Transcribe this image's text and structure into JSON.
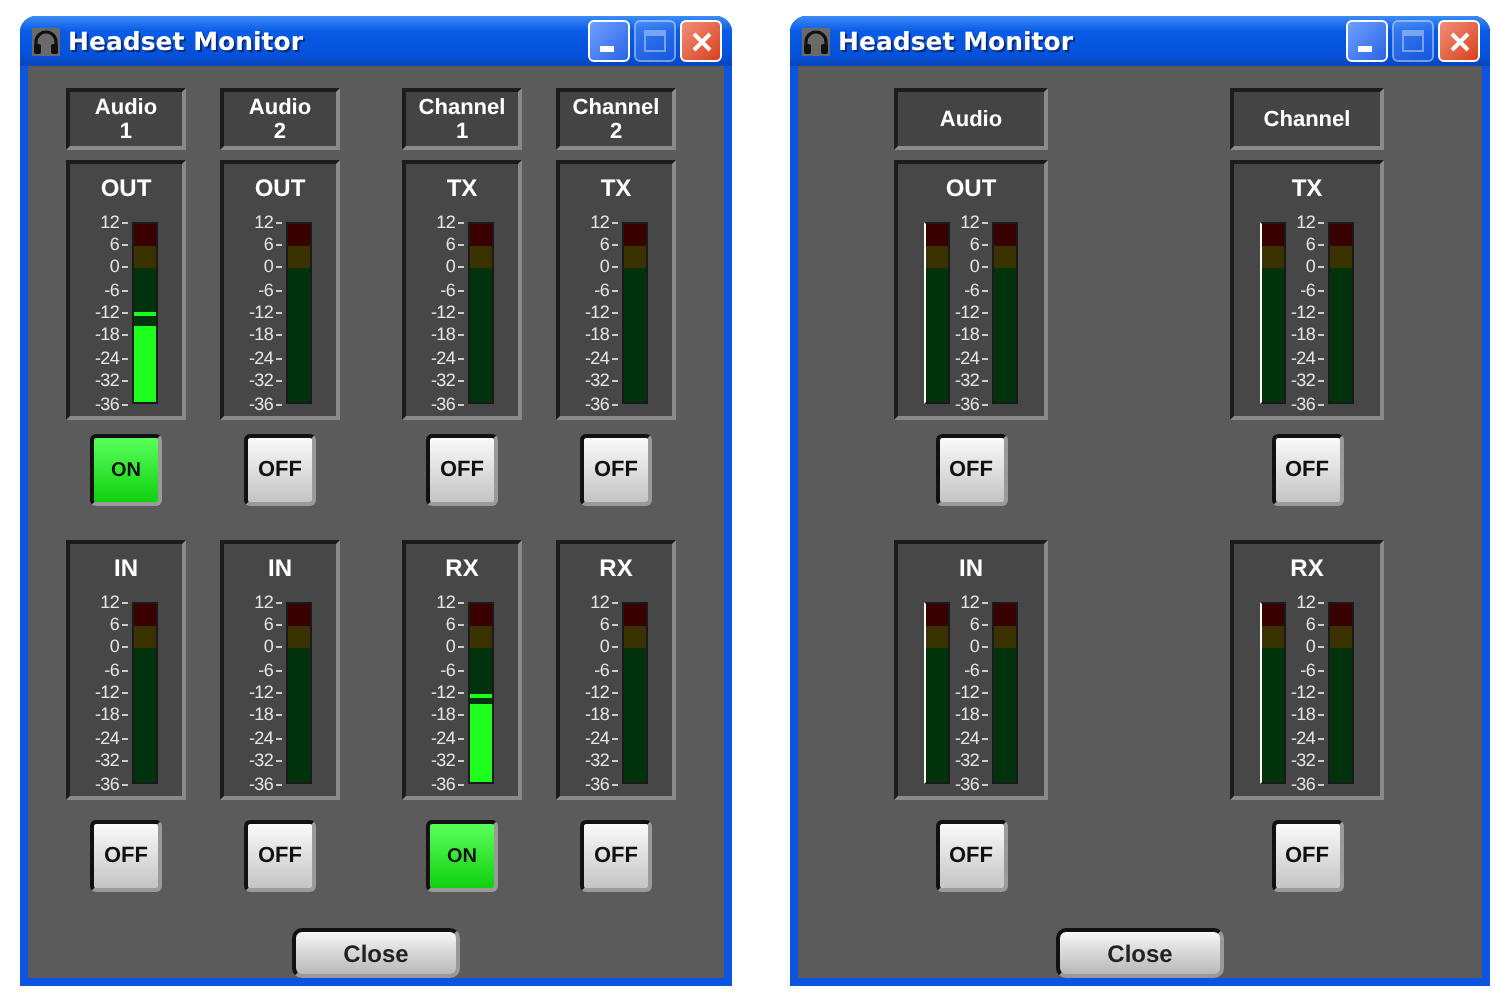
{
  "windows": [
    {
      "title": "Headset Monitor",
      "title_buttons": [
        {
          "kind": "minimize",
          "disabled": false
        },
        {
          "kind": "maximize",
          "disabled": true
        },
        {
          "kind": "close",
          "disabled": false
        }
      ],
      "columns": [
        {
          "header": "Audio 1",
          "meters": [
            {
              "label": "OUT",
              "scale": [
                "12",
                "6",
                "0",
                "-6",
                "-12",
                "-18",
                "-24",
                "-32",
                "-36"
              ],
              "bars": [
                {
                  "level": 0.43,
                  "peak": {
                    "level": 0.5
                  }
                }
              ],
              "button": {
                "label": "ON",
                "on": true
              }
            },
            {
              "label": "IN",
              "scale": [
                "12",
                "6",
                "0",
                "-6",
                "-12",
                "-18",
                "-24",
                "-32",
                "-36"
              ],
              "bars": [
                {
                  "level": 0
                }
              ],
              "button": {
                "label": "OFF",
                "on": false
              }
            }
          ]
        },
        {
          "header": "Audio 2",
          "meters": [
            {
              "label": "OUT",
              "scale": [
                "12",
                "6",
                "0",
                "-6",
                "-12",
                "-18",
                "-24",
                "-32",
                "-36"
              ],
              "bars": [
                {
                  "level": 0
                }
              ],
              "button": {
                "label": "OFF",
                "on": false
              }
            },
            {
              "label": "IN",
              "scale": [
                "12",
                "6",
                "0",
                "-6",
                "-12",
                "-18",
                "-24",
                "-32",
                "-36"
              ],
              "bars": [
                {
                  "level": 0
                }
              ],
              "button": {
                "label": "OFF",
                "on": false
              }
            }
          ]
        },
        {
          "header": "Channel 1",
          "meters": [
            {
              "label": "TX",
              "scale": [
                "12",
                "6",
                "0",
                "-6",
                "-12",
                "-18",
                "-24",
                "-32",
                "-36"
              ],
              "bars": [
                {
                  "level": 0
                }
              ],
              "button": {
                "label": "OFF",
                "on": false
              }
            },
            {
              "label": "RX",
              "scale": [
                "12",
                "6",
                "0",
                "-6",
                "-12",
                "-18",
                "-24",
                "-32",
                "-36"
              ],
              "bars": [
                {
                  "level": 0.44,
                  "peak": {
                    "level": 0.48
                  }
                }
              ],
              "button": {
                "label": "ON",
                "on": true
              }
            }
          ]
        },
        {
          "header": "Channel 2",
          "meters": [
            {
              "label": "TX",
              "scale": [
                "12",
                "6",
                "0",
                "-6",
                "-12",
                "-18",
                "-24",
                "-32",
                "-36"
              ],
              "bars": [
                {
                  "level": 0
                }
              ],
              "button": {
                "label": "OFF",
                "on": false
              }
            },
            {
              "label": "RX",
              "scale": [
                "12",
                "6",
                "0",
                "-6",
                "-12",
                "-18",
                "-24",
                "-32",
                "-36"
              ],
              "bars": [
                {
                  "level": 0
                }
              ],
              "button": {
                "label": "OFF",
                "on": false
              }
            }
          ]
        }
      ],
      "close_button": "Close"
    },
    {
      "title": "Headset Monitor",
      "title_buttons": [
        {
          "kind": "minimize",
          "disabled": false
        },
        {
          "kind": "maximize",
          "disabled": true
        },
        {
          "kind": "close",
          "disabled": false
        }
      ],
      "columns": [
        {
          "header": "Audio",
          "meters": [
            {
              "label": "OUT",
              "scale": [
                "12",
                "6",
                "0",
                "-6",
                "-12",
                "-18",
                "-24",
                "-32",
                "-36"
              ],
              "bars": [
                {
                  "level": 0
                },
                {
                  "level": 0
                }
              ],
              "button": {
                "label": "OFF",
                "on": false
              }
            },
            {
              "label": "IN",
              "scale": [
                "12",
                "6",
                "0",
                "-6",
                "-12",
                "-18",
                "-24",
                "-32",
                "-36"
              ],
              "bars": [
                {
                  "level": 0
                },
                {
                  "level": 0
                }
              ],
              "button": {
                "label": "OFF",
                "on": false
              }
            }
          ]
        },
        {
          "header": "Channel",
          "meters": [
            {
              "label": "TX",
              "scale": [
                "12",
                "6",
                "0",
                "-6",
                "-12",
                "-18",
                "-24",
                "-32",
                "-36"
              ],
              "bars": [
                {
                  "level": 0
                },
                {
                  "level": 0
                }
              ],
              "button": {
                "label": "OFF",
                "on": false
              }
            },
            {
              "label": "RX",
              "scale": [
                "12",
                "6",
                "0",
                "-6",
                "-12",
                "-18",
                "-24",
                "-32",
                "-36"
              ],
              "bars": [
                {
                  "level": 0
                },
                {
                  "level": 0
                }
              ],
              "button": {
                "label": "OFF",
                "on": false
              }
            }
          ]
        }
      ],
      "close_button": "Close"
    }
  ]
}
